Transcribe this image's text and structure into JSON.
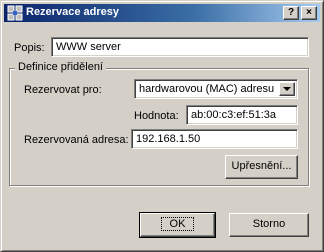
{
  "window": {
    "title": "Rezervace adresy",
    "help_button": "?",
    "close_button": "×"
  },
  "form": {
    "name_label": "Popis:",
    "name_value": "WWW server",
    "group_title": "Definice přidělení",
    "reserve_for_label": "Rezervovat pro:",
    "reserve_for_value": "hardwarovou (MAC) adresu",
    "value_label": "Hodnota:",
    "value_value": "ab:00:c3:ef:51:3a",
    "reserved_addr_label": "Rezervovaná adresa:",
    "reserved_addr_value": "192.168.1.50",
    "details_button": "Upřesnění..."
  },
  "footer": {
    "ok_button": "OK",
    "cancel_button": "Storno"
  }
}
